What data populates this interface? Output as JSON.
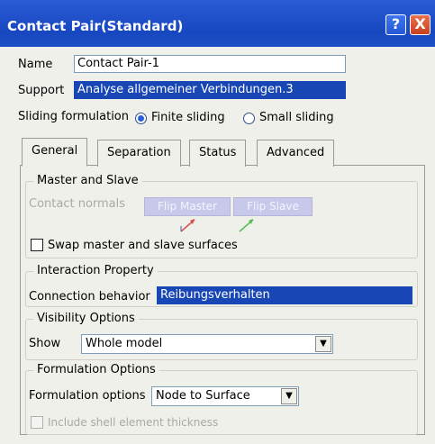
{
  "window": {
    "title": "Contact Pair(Standard)"
  },
  "title_buttons": {
    "help": "?",
    "close": "X"
  },
  "name": {
    "label": "Name",
    "value": "Contact Pair-1"
  },
  "support": {
    "label": "Support",
    "value": "Analyse allgemeiner Verbindungen.3"
  },
  "sliding": {
    "label": "Sliding formulation",
    "options": [
      "Finite sliding",
      "Small sliding"
    ],
    "selected": "Finite sliding"
  },
  "tabs": [
    "General",
    "Separation",
    "Status",
    "Advanced"
  ],
  "active_tab": "General",
  "master_slave": {
    "title": "Master and Slave",
    "contact_normals_label": "Contact normals",
    "flip_master": "Flip Master",
    "flip_slave": "Flip Slave",
    "swap_label": "Swap master and slave surfaces"
  },
  "interaction": {
    "title": "Interaction Property",
    "label": "Connection behavior",
    "value": "Reibungsverhalten"
  },
  "visibility": {
    "title": "Visibility Options",
    "label": "Show",
    "value": "Whole model"
  },
  "formulation": {
    "title": "Formulation Options",
    "label": "Formulation options",
    "value": "Node to Surface",
    "shell_label": "Include shell element thickness"
  },
  "colors": {
    "titlebar": "#1f4fc9",
    "selection": "#1846b4"
  }
}
